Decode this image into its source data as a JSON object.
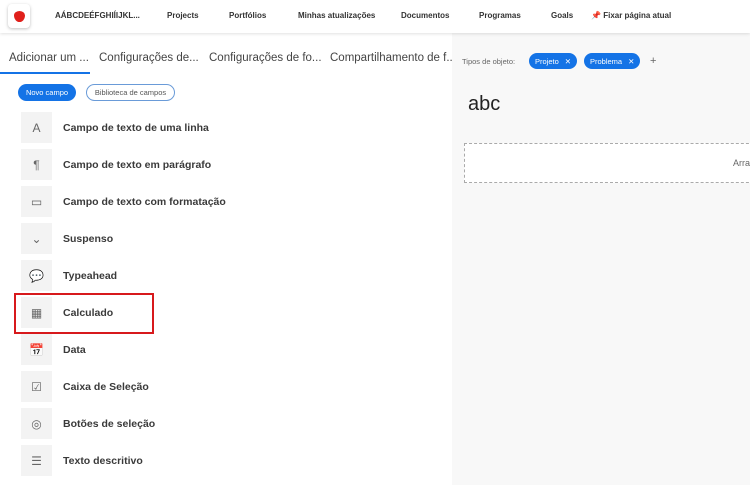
{
  "topnav": {
    "app_name": "AÁBCDEÉFGHIÍIJKL...",
    "items": [
      "Projects",
      "Portfólios",
      "Minhas atualizações",
      "Documentos",
      "Programas",
      "Goals"
    ],
    "pin_label": "Fixar página atual"
  },
  "tabs": [
    "Adicionar um ...",
    "Configurações de...",
    "Configurações de fo...",
    "Compartilhamento de f..."
  ],
  "buttons": {
    "new_field": "Novo campo",
    "field_library": "Biblioteca de campos"
  },
  "fields": [
    {
      "label": "Campo de texto de uma linha",
      "icon": "A"
    },
    {
      "label": "Campo de texto em parágrafo",
      "icon": "¶"
    },
    {
      "label": "Campo de texto com formatação",
      "icon": "▭"
    },
    {
      "label": "Suspenso",
      "icon": "⌄"
    },
    {
      "label": "Typeahead",
      "icon": "💬"
    },
    {
      "label": "Calculado",
      "icon": "▦"
    },
    {
      "label": "Data",
      "icon": "📅"
    },
    {
      "label": "Caixa de Seleção",
      "icon": "☑"
    },
    {
      "label": "Botões de seleção",
      "icon": "◎"
    },
    {
      "label": "Texto descritivo",
      "icon": "☰"
    }
  ],
  "right": {
    "object_types_label": "Tipos de objeto:",
    "chips": [
      "Projeto",
      "Problema"
    ],
    "plus": "+",
    "form_title": "abc",
    "drop_text": "Arra"
  },
  "colors": {
    "accent": "#1473e6",
    "highlight": "#d7191c"
  }
}
